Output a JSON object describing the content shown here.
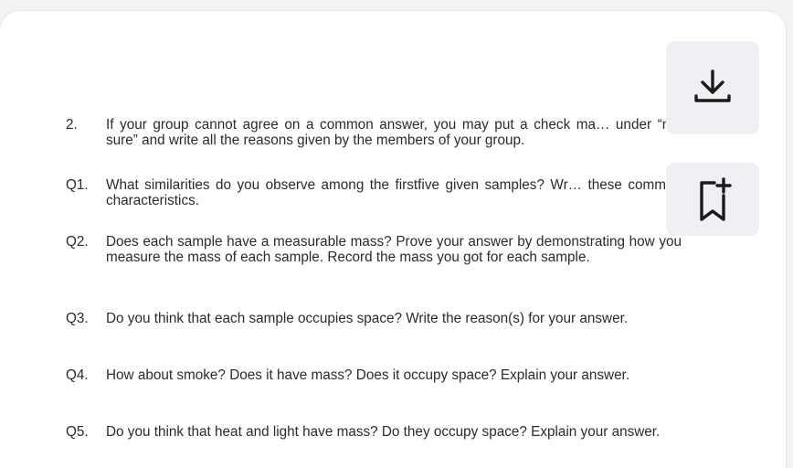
{
  "document": {
    "items": [
      {
        "number": "2.",
        "text": "If your group cannot agree on a common answer, you may put a check ma… under “not sure” and write all the reasons given by the members of your group."
      },
      {
        "number": "Q1.",
        "text": "What similarities do you observe among the firstfive given samples? Wr… these common characteristics."
      },
      {
        "number": "Q2.",
        "text": "Does each sample have a measurable mass? Prove your answer by demonstrating how you measure the mass of each sample. Record the mass you got for each sample."
      },
      {
        "number": "Q3.",
        "text": "Do you think that each sample occupies space? Write the reason(s) for your answer."
      },
      {
        "number": "Q4.",
        "text": "How about smoke? Does it have mass? Does it occupy space? Explain your answer."
      },
      {
        "number": "Q5.",
        "text": "Do you think that heat and light have mass? Do they occupy space? Explain your answer."
      }
    ]
  },
  "actions": {
    "download_icon": "download-icon",
    "bookmark_icon": "bookmark-add-icon"
  },
  "colors": {
    "text": "#2b2b2b",
    "button_bg": "#eef0f3",
    "icon": "#1a1a1a"
  }
}
